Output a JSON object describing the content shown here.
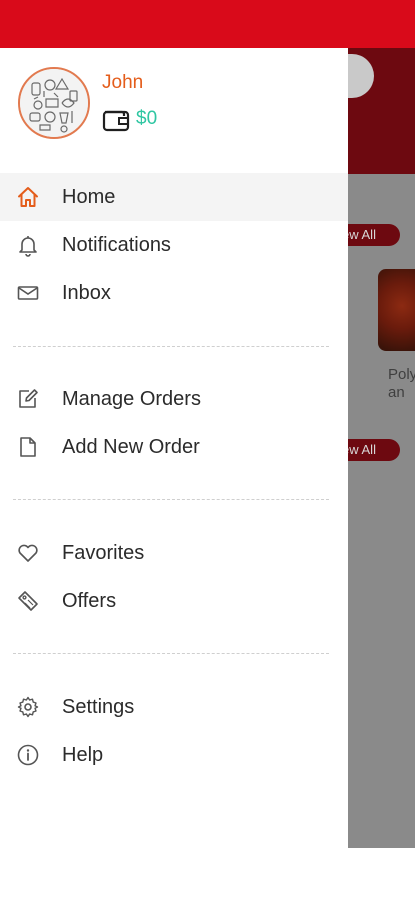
{
  "colors": {
    "brand_red": "#d90a1a",
    "accent_orange": "#e45d1b",
    "wallet_green": "#2ec6a2",
    "overlay_gray": "#8a8a8a"
  },
  "profile": {
    "name": "John",
    "wallet_balance": "$0",
    "avatar_icon": "avatar-pattern",
    "wallet_icon": "wallet-icon"
  },
  "menu": {
    "home": {
      "label": "Home",
      "icon": "home-icon",
      "active": true
    },
    "notifications": {
      "label": "Notifications",
      "icon": "bell-icon"
    },
    "inbox": {
      "label": "Inbox",
      "icon": "mail-icon"
    },
    "manage_orders": {
      "label": "Manage Orders",
      "icon": "edit-icon"
    },
    "add_new_order": {
      "label": "Add New Order",
      "icon": "document-icon"
    },
    "favorites": {
      "label": "Favorites",
      "icon": "heart-icon"
    },
    "offers": {
      "label": "Offers",
      "icon": "tag-icon"
    },
    "settings": {
      "label": "Settings",
      "icon": "gear-icon"
    },
    "help": {
      "label": "Help",
      "icon": "info-icon"
    }
  },
  "background": {
    "view_all_1": "ew All",
    "view_all_2": "ew All",
    "food_line_1": "Poly",
    "food_line_2": "an"
  }
}
